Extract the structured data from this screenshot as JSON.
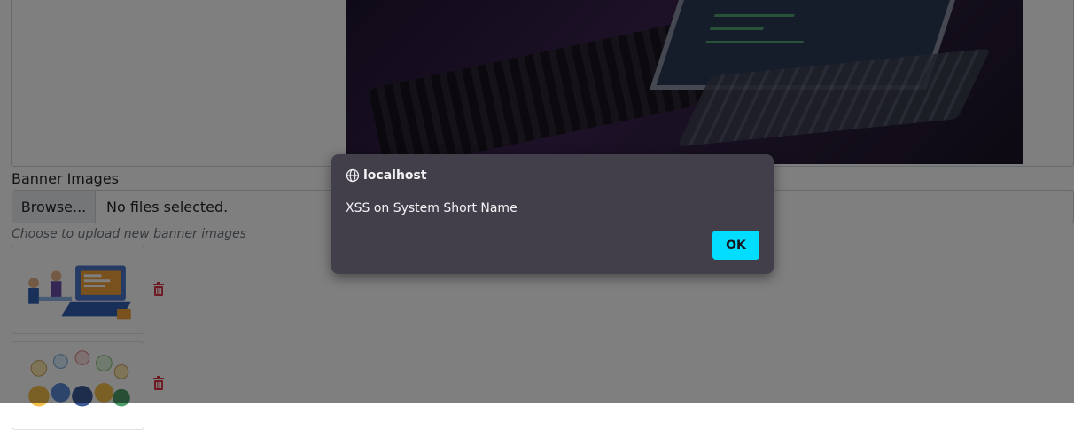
{
  "form": {
    "banner_label": "Banner Images",
    "browse_label": "Browse...",
    "file_status": "No files selected.",
    "help_text": "Choose to upload new banner images"
  },
  "banner_images": [
    {
      "icon": "trash-icon"
    },
    {
      "icon": "trash-icon"
    }
  ],
  "alert": {
    "origin": "localhost",
    "message": "XSS on System Short Name",
    "ok_label": "OK",
    "icon": "globe-icon"
  },
  "colors": {
    "overlay": "rgba(0,0,0,0.5)",
    "dialog_bg": "#423f4b",
    "ok_button": "#00ddff",
    "trash": "#dc3545"
  }
}
